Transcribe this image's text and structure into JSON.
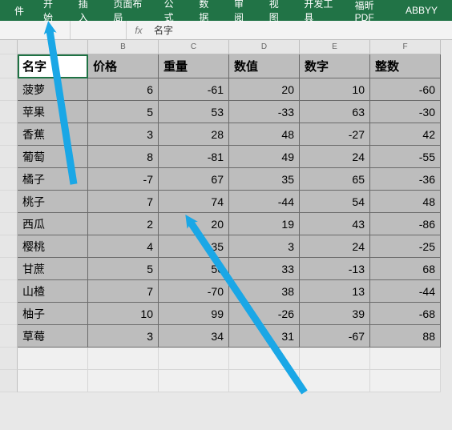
{
  "ribbon": {
    "tabs": [
      "件",
      "开始",
      "插入",
      "页面布局",
      "公式",
      "数据",
      "审阅",
      "视图",
      "开发工具",
      "福昕PDF",
      "ABBYY"
    ]
  },
  "formula_bar": {
    "name_box": "",
    "fx_label": "fx",
    "value": "名字"
  },
  "columns": [
    "A",
    "B",
    "C",
    "D",
    "E",
    "F"
  ],
  "active_cell_column": "A",
  "headers": [
    "名字",
    "价格",
    "重量",
    "数值",
    "数字",
    "整数"
  ],
  "rows": [
    {
      "name": "菠萝",
      "values": [
        6,
        -61,
        20,
        10,
        -60
      ]
    },
    {
      "name": "苹果",
      "values": [
        5,
        53,
        -33,
        63,
        -30
      ]
    },
    {
      "name": "香蕉",
      "values": [
        3,
        28,
        48,
        -27,
        42
      ]
    },
    {
      "name": "葡萄",
      "values": [
        8,
        -81,
        49,
        24,
        -55
      ]
    },
    {
      "name": "橘子",
      "values": [
        -7,
        67,
        35,
        65,
        -36
      ]
    },
    {
      "name": "桃子",
      "values": [
        7,
        74,
        -44,
        54,
        48
      ]
    },
    {
      "name": "西瓜",
      "values": [
        2,
        20,
        19,
        43,
        -86
      ]
    },
    {
      "name": "樱桃",
      "values": [
        4,
        -35,
        3,
        24,
        -25
      ]
    },
    {
      "name": "甘蔗",
      "values": [
        5,
        50,
        33,
        -13,
        68
      ]
    },
    {
      "name": "山楂",
      "values": [
        7,
        -70,
        38,
        13,
        -44
      ]
    },
    {
      "name": "柚子",
      "values": [
        10,
        99,
        -26,
        39,
        -68
      ]
    },
    {
      "name": "草莓",
      "values": [
        3,
        34,
        31,
        -67,
        88
      ]
    }
  ],
  "annotation_color": "#1aa7e6",
  "chart_data": {
    "type": "table",
    "title": "",
    "columns": [
      "名字",
      "价格",
      "重量",
      "数值",
      "数字",
      "整数"
    ],
    "data": [
      [
        "菠萝",
        6,
        -61,
        20,
        10,
        -60
      ],
      [
        "苹果",
        5,
        53,
        -33,
        63,
        -30
      ],
      [
        "香蕉",
        3,
        28,
        48,
        -27,
        42
      ],
      [
        "葡萄",
        8,
        -81,
        49,
        24,
        -55
      ],
      [
        "橘子",
        -7,
        67,
        35,
        65,
        -36
      ],
      [
        "桃子",
        7,
        74,
        -44,
        54,
        48
      ],
      [
        "西瓜",
        2,
        20,
        19,
        43,
        -86
      ],
      [
        "樱桃",
        4,
        -35,
        3,
        24,
        -25
      ],
      [
        "甘蔗",
        5,
        50,
        33,
        -13,
        68
      ],
      [
        "山楂",
        7,
        -70,
        38,
        13,
        -44
      ],
      [
        "柚子",
        10,
        99,
        -26,
        39,
        -68
      ],
      [
        "草莓",
        3,
        34,
        31,
        -67,
        88
      ]
    ]
  }
}
